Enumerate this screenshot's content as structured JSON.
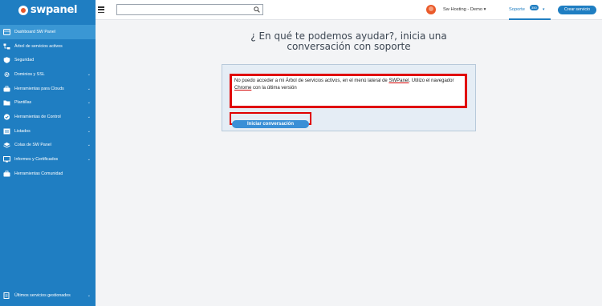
{
  "brand": {
    "name": "swpanel"
  },
  "sidebar": {
    "items": [
      {
        "label": "Dashboard SW Panel",
        "icon": "dashboard-icon",
        "chevron": false,
        "active": true
      },
      {
        "label": "Árbol de servicios activos",
        "icon": "tree-icon",
        "chevron": false
      },
      {
        "label": "Seguridad",
        "icon": "shield-icon",
        "chevron": false
      },
      {
        "label": "Dominios y SSL",
        "icon": "gear-icon",
        "chevron": true
      },
      {
        "label": "Herramientas para Clouds",
        "icon": "toolbox-icon",
        "chevron": true
      },
      {
        "label": "Plantillas",
        "icon": "folder-icon",
        "chevron": true
      },
      {
        "label": "Herramientas de Control",
        "icon": "check-circle-icon",
        "chevron": true
      },
      {
        "label": "Listados",
        "icon": "list-icon",
        "chevron": true
      },
      {
        "label": "Colas de SW Panel",
        "icon": "layers-icon",
        "chevron": true
      },
      {
        "label": "Informes y Certificados",
        "icon": "report-icon",
        "chevron": true
      },
      {
        "label": "Herramientas Comunidad",
        "icon": "briefcase-icon",
        "chevron": false
      }
    ],
    "bottom": {
      "label": "Últimos servicios gestionados",
      "icon": "history-icon",
      "chevron": true
    },
    "chevron_glyph": "⌄"
  },
  "topbar": {
    "search_value": "",
    "account": "Sw Hosting - Demo",
    "account_caret": "▾",
    "support_label": "Soporte",
    "support_badge": "350",
    "support_caret": "▾",
    "create_label": "Crear servicio"
  },
  "main": {
    "heading_line1": "¿ En qué te podemos ayudar?, inicia una",
    "heading_line2": "conversación con soporte",
    "message_part1": "No puedo acceder a mi Árbol de servicios activos, en el menú lateral de ",
    "message_word1": "SWPanel",
    "message_part2": ". Utilizo el navegador ",
    "message_word2": "Chrome",
    "message_part3": " con la última versión",
    "start_label": "Iniciar conversación"
  },
  "colors": {
    "sidebar_bg": "#1f7ec2",
    "sidebar_active": "#3a97d4",
    "accent": "#1f7ec2",
    "highlight": "#e00000",
    "panel_bg": "#e5edf5"
  }
}
